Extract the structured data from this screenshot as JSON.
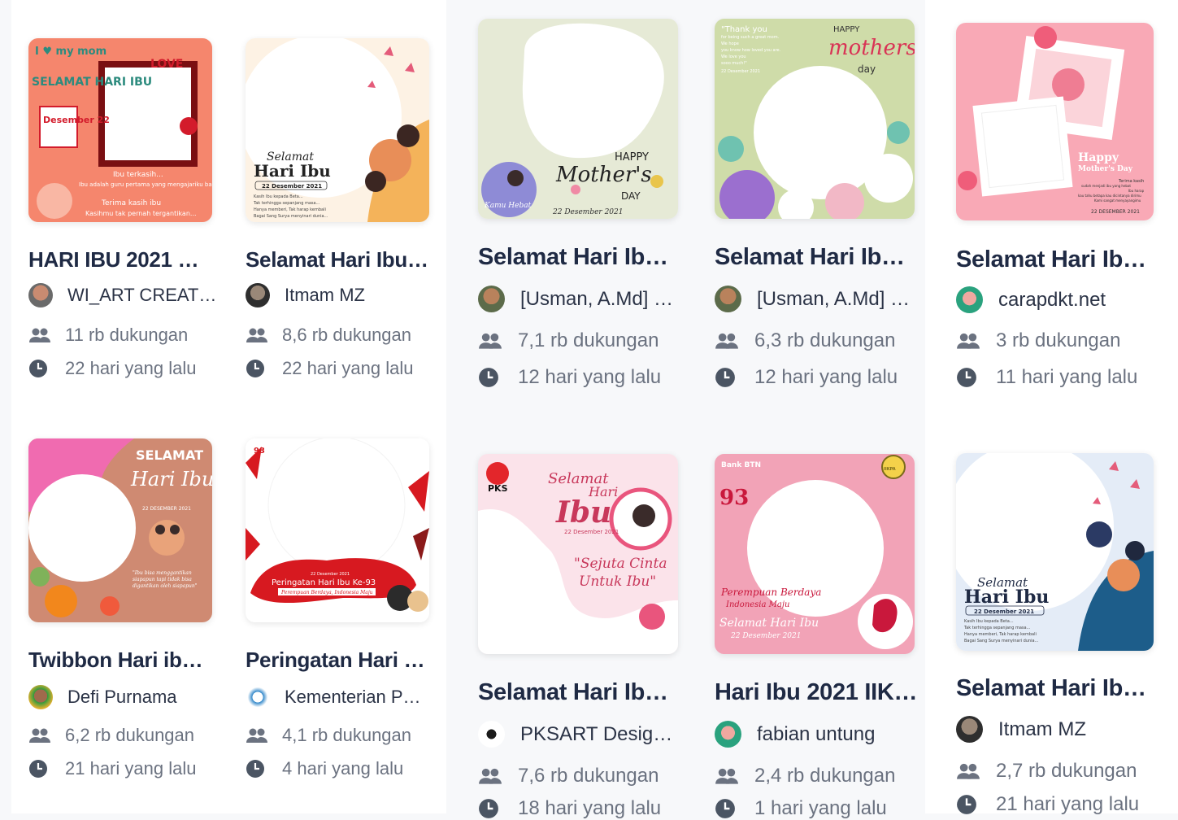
{
  "cards": [
    {
      "title": "HARI IBU 2021 S…",
      "creator": "WI_ART CREAT…",
      "supports": "11 rb dukungan",
      "time": "22 hari yang lalu",
      "thumb": {
        "bg": "#f05a3c",
        "accent": "#ffffff",
        "texts": [
          "I ♥ my mom",
          "LOVE",
          "SELAMAT HARI IBU",
          "Desember 22",
          "Ibu terkasih...",
          "Ibu adalah guru pertama yang mengajariku banyak hal...",
          "Terima kasih ibu",
          "Kasihmu tak pernah tergantikan..."
        ]
      }
    },
    {
      "title": "Selamat Hari Ibu …",
      "creator": "Itmam MZ",
      "supports": "8,6 rb dukungan",
      "time": "22 hari yang lalu",
      "thumb": {
        "bg": "#fdf2e4",
        "accent": "#e45c7a",
        "texts": [
          "Selamat",
          "Hari Ibu",
          "22 Desember 2021",
          "Kasih Ibu kepada Beta...",
          "Tak terhingga sepanjang masa...",
          "Hanya memberi, Tak harap kembali",
          "Bagai Sang Surya menyinari dunia..."
        ]
      }
    },
    {
      "title": "Selamat Hari Ibu …",
      "creator": "[Usman, A.Md] …",
      "supports": "7,1 rb dukungan",
      "time": "12 hari yang lalu",
      "thumb": {
        "bg": "#e6ead6",
        "accent": "#3d3d3d",
        "texts": [
          "HAPPY",
          "Mother's",
          "DAY",
          "Kamu Hebat",
          "22 Desember 2021"
        ]
      }
    },
    {
      "title": "Selamat Hari Ibu …",
      "creator": "[Usman, A.Md] …",
      "supports": "6,3 rb dukungan",
      "time": "12 hari yang lalu",
      "thumb": {
        "bg": "#cfdca9",
        "accent": "#d93355",
        "texts": [
          "\"Thank you",
          "for being such a great mom.",
          "We hope",
          "you know how loved you are.",
          "We love you",
          "sooo much!\"",
          "22 Desember 2021",
          "HAPPY",
          "mothers",
          "day"
        ]
      }
    },
    {
      "title": "Selamat Hari Ibu …",
      "creator": "carapdkt.net",
      "supports": "3 rb dukungan",
      "time": "11 hari yang lalu",
      "thumb": {
        "bg": "#f9a9b6",
        "accent": "#ffffff",
        "texts": [
          "Happy",
          "Mother's Day",
          "Terima kasih",
          "sudah menjadi ibu yang hebat",
          "Ibu harap",
          "kau tahu betapa kau dicintanya dirimu",
          "Kami sangat menyayangimu",
          "22 DESEMBER 2021"
        ]
      }
    },
    {
      "title": "Twibbon Hari ibu…",
      "creator": "Defi Purnama",
      "supports": "6,2 rb dukungan",
      "time": "21 hari yang lalu",
      "thumb": {
        "bg": "#cf8a72",
        "accent": "#ffffff",
        "texts": [
          "SELAMAT",
          "Hari Ibu",
          "22 DESEMBER 2021",
          "\"Ibu bisa menggantikan siapapun tapi tidak bisa digantikan oleh siapapun\""
        ]
      }
    },
    {
      "title": "Peringatan Hari I…",
      "creator": "Kementerian P…",
      "supports": "4,1 rb dukungan",
      "time": "4 hari yang lalu",
      "thumb": {
        "bg": "#ffffff",
        "accent": "#d71920",
        "texts": [
          "93",
          "22 Desember 2021",
          "Peringatan Hari Ibu Ke-93",
          "Perempuan Berdaya, Indonesia Maju"
        ]
      }
    },
    {
      "title": "Selamat Hari Ibu…",
      "creator": "PKSART Design…",
      "supports": "7,6 rb dukungan",
      "time": "18 hari yang lalu",
      "thumb": {
        "bg": "#fbe3ea",
        "accent": "#c8385b",
        "texts": [
          "PKS",
          "Selamat",
          "Hari",
          "Ibu",
          "22 Desember 2021",
          "\"Sejuta Cinta",
          "Untuk Ibu\""
        ]
      }
    },
    {
      "title": "Hari Ibu 2021 IIKPA",
      "creator": "fabian untung",
      "supports": "2,4 rb dukungan",
      "time": "1 hari yang lalu",
      "thumb": {
        "bg": "#f2a3b7",
        "accent": "#c9183c",
        "texts": [
          "Bank BTN",
          "93",
          "IIKPA",
          "Perempuan Berdaya",
          "Indonesia Maju",
          "Selamat Hari Ibu",
          "22 Desember 2021"
        ]
      }
    },
    {
      "title": "Selamat Hari Ibu …",
      "creator": "Itmam MZ",
      "supports": "2,7 rb dukungan",
      "time": "21 hari yang lalu",
      "thumb": {
        "bg": "#e4ecf7",
        "accent": "#e45c7a",
        "texts": [
          "Selamat",
          "Hari Ibu",
          "22 Desember 2021",
          "Kasih Ibu kepada Beta...",
          "Tak terhingga sepanjang masa...",
          "Hanya memberi, Tak harap kembali",
          "Bagai Sang Surya menyinari dunia..."
        ]
      }
    }
  ]
}
